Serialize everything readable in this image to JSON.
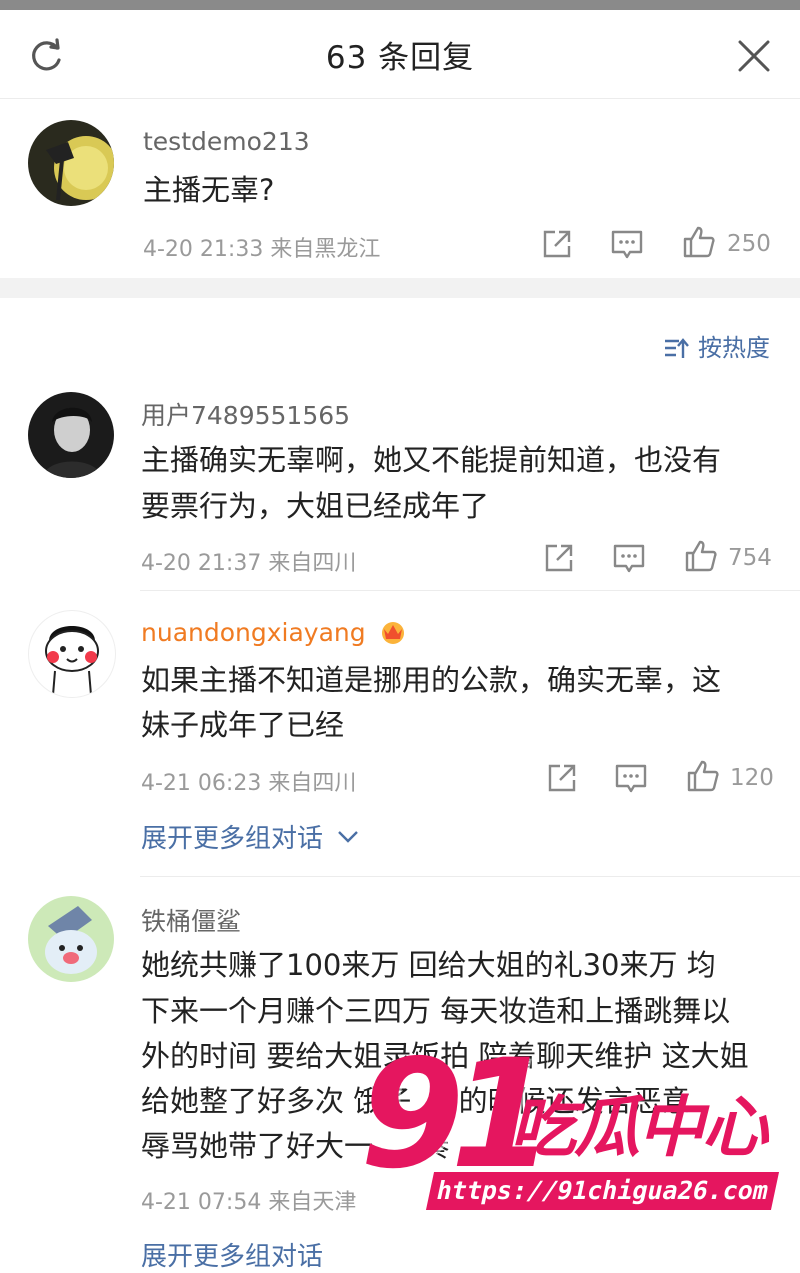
{
  "header": {
    "title": "63 条回复"
  },
  "top_comment": {
    "username": "testdemo213",
    "text": "主播无辜?",
    "meta": "4-20 21:33 来自黑龙江",
    "likes": "250"
  },
  "sort": {
    "label": "按热度"
  },
  "replies": [
    {
      "username": "用户7489551565",
      "text_lines": [
        "主播确实无辜啊，她又不能提前知道，也没有",
        "要票行为，大姐已经成年了"
      ],
      "meta": "4-20 21:37 来自四川",
      "likes": "754"
    },
    {
      "username": "nuandongxiayang",
      "text_lines": [
        "如果主播不知道是挪用的公款，确实无辜，这",
        "妹子成年了已经"
      ],
      "meta": "4-21 06:23 来自四川",
      "likes": "120",
      "expand_label": "展开更多组对话"
    },
    {
      "username": "铁桶僵鲨",
      "text_lines": [
        "她统共赚了100来万 回给大姐的礼30来万 均",
        "下来一个月赚个三四万 每天妆造和上播跳舞以",
        "外的时间 要给大姐录饭拍 陪着聊天维护 这大姐",
        "给她整了好多次 饿子 … 的时候还发言恶意",
        "辱骂她带了好大一 … 奏 …"
      ],
      "meta": "4-21 07:54 来自天津",
      "expand_label": "展开更多组对话"
    }
  ],
  "watermark": {
    "number": "91",
    "text": "吃瓜中心",
    "url": "https://91chigua26.com"
  },
  "colors": {
    "link": "#4a6fa5",
    "vip_name": "#f07b22",
    "watermark": "#e5165f"
  }
}
